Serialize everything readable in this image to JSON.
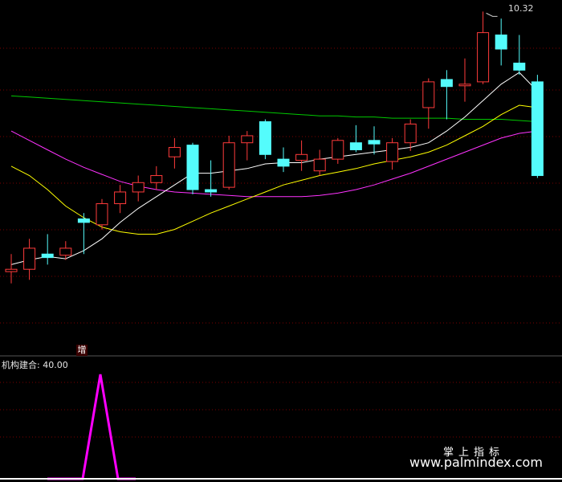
{
  "chart_data": {
    "type": "candlestick",
    "high_label": "10.32",
    "badge_text": "增",
    "indicator": {
      "name": "机构建合",
      "value_text": "40.00",
      "values": [
        0,
        0,
        0,
        40,
        0,
        0,
        0,
        0,
        0,
        0,
        0,
        0,
        0,
        0,
        0,
        0,
        0,
        0,
        0,
        0,
        0,
        0,
        0,
        0,
        0,
        0,
        0,
        0,
        0,
        0,
        0,
        0
      ]
    },
    "candles": [
      {
        "o": 8.1,
        "c": 8.12,
        "h": 8.25,
        "l": 8.0
      },
      {
        "o": 8.12,
        "c": 8.3,
        "h": 8.38,
        "l": 8.03
      },
      {
        "o": 8.25,
        "c": 8.22,
        "h": 8.42,
        "l": 8.16
      },
      {
        "o": 8.24,
        "c": 8.3,
        "h": 8.36,
        "l": 8.2
      },
      {
        "o": 8.55,
        "c": 8.52,
        "h": 8.6,
        "l": 8.25
      },
      {
        "o": 8.5,
        "c": 8.68,
        "h": 8.72,
        "l": 8.46
      },
      {
        "o": 8.68,
        "c": 8.78,
        "h": 8.84,
        "l": 8.6
      },
      {
        "o": 8.78,
        "c": 8.86,
        "h": 8.92,
        "l": 8.7
      },
      {
        "o": 8.86,
        "c": 8.92,
        "h": 9.0,
        "l": 8.8
      },
      {
        "o": 9.08,
        "c": 9.16,
        "h": 9.24,
        "l": 8.98
      },
      {
        "o": 9.18,
        "c": 8.8,
        "h": 9.2,
        "l": 8.76
      },
      {
        "o": 8.8,
        "c": 8.78,
        "h": 9.05,
        "l": 8.74
      },
      {
        "o": 8.82,
        "c": 9.2,
        "h": 9.26,
        "l": 8.8
      },
      {
        "o": 9.2,
        "c": 9.26,
        "h": 9.3,
        "l": 9.05
      },
      {
        "o": 9.38,
        "c": 9.1,
        "h": 9.4,
        "l": 9.06
      },
      {
        "o": 9.06,
        "c": 9.0,
        "h": 9.16,
        "l": 8.95
      },
      {
        "o": 9.05,
        "c": 9.1,
        "h": 9.22,
        "l": 8.96
      },
      {
        "o": 8.96,
        "c": 9.06,
        "h": 9.14,
        "l": 8.92
      },
      {
        "o": 9.06,
        "c": 9.22,
        "h": 9.24,
        "l": 9.02
      },
      {
        "o": 9.2,
        "c": 9.14,
        "h": 9.35,
        "l": 9.12
      },
      {
        "o": 9.22,
        "c": 9.19,
        "h": 9.34,
        "l": 9.1
      },
      {
        "o": 9.04,
        "c": 9.2,
        "h": 9.24,
        "l": 8.97
      },
      {
        "o": 9.2,
        "c": 9.36,
        "h": 9.4,
        "l": 9.13
      },
      {
        "o": 9.5,
        "c": 9.72,
        "h": 9.75,
        "l": 9.32
      },
      {
        "o": 9.74,
        "c": 9.68,
        "h": 9.82,
        "l": 9.4
      },
      {
        "o": 9.7,
        "c": 9.7,
        "h": 9.92,
        "l": 9.55
      },
      {
        "o": 9.72,
        "c": 10.14,
        "h": 10.32,
        "l": 9.7
      },
      {
        "o": 10.12,
        "c": 10.0,
        "h": 10.26,
        "l": 9.86
      },
      {
        "o": 9.88,
        "c": 9.82,
        "h": 10.12,
        "l": 9.78
      },
      {
        "o": 9.72,
        "c": 8.92,
        "h": 9.78,
        "l": 8.9
      }
    ],
    "ma_short": [
      8.16,
      8.2,
      8.23,
      8.21,
      8.28,
      8.38,
      8.52,
      8.64,
      8.74,
      8.84,
      8.94,
      8.94,
      8.96,
      8.98,
      9.02,
      9.03,
      9.03,
      9.06,
      9.08,
      9.1,
      9.12,
      9.14,
      9.16,
      9.2,
      9.3,
      9.42,
      9.56,
      9.7,
      9.8,
      9.64
    ],
    "ma_mid": [
      9.0,
      8.92,
      8.8,
      8.66,
      8.56,
      8.48,
      8.44,
      8.42,
      8.42,
      8.46,
      8.53,
      8.6,
      8.66,
      8.72,
      8.78,
      8.84,
      8.88,
      8.92,
      8.95,
      8.98,
      9.02,
      9.05,
      9.08,
      9.12,
      9.18,
      9.26,
      9.34,
      9.44,
      9.52,
      9.5
    ],
    "ma_long": [
      9.3,
      9.22,
      9.14,
      9.06,
      8.99,
      8.93,
      8.87,
      8.83,
      8.8,
      8.78,
      8.77,
      8.76,
      8.75,
      8.74,
      8.74,
      8.74,
      8.74,
      8.75,
      8.77,
      8.8,
      8.84,
      8.89,
      8.94,
      9.0,
      9.06,
      9.12,
      9.18,
      9.24,
      9.28,
      9.3
    ],
    "ma_extra": [
      9.6,
      9.59,
      9.58,
      9.57,
      9.56,
      9.55,
      9.54,
      9.53,
      9.52,
      9.51,
      9.5,
      9.49,
      9.48,
      9.47,
      9.46,
      9.45,
      9.44,
      9.43,
      9.43,
      9.42,
      9.42,
      9.41,
      9.41,
      9.41,
      9.41,
      9.4,
      9.4,
      9.4,
      9.39,
      9.38
    ],
    "colors": {
      "up": "#ff3b3b",
      "down": "#54fcfc",
      "ma_short": "#ffffff",
      "ma_mid": "#ffff00",
      "ma_long": "#ff33ff",
      "ma_extra": "#00c800",
      "indicator": "#ff00ff",
      "grid": "#7a0000"
    }
  },
  "watermark": {
    "cn": "掌上指标",
    "url": "www.palmindex.com"
  }
}
